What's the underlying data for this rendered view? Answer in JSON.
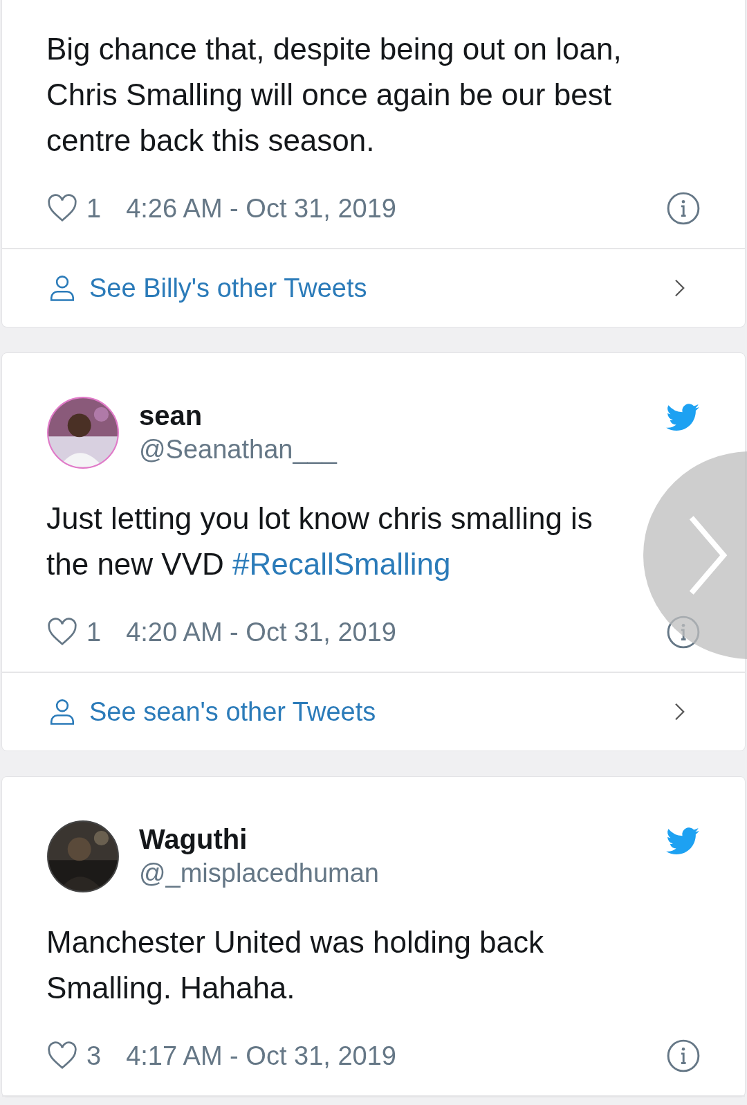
{
  "tweets": [
    {
      "text": "Big chance that, despite being out on loan, Chris Smalling will once again be our best centre back this season.",
      "likes": "1",
      "time": "4:26 AM - Oct 31, 2019",
      "more_link": "See Billy's other Tweets"
    },
    {
      "name": "sean",
      "handle": "@Seanathan___",
      "text": "Just letting you lot know chris smalling is the new VVD",
      "hashtag": "#RecallSmalling",
      "likes": "1",
      "time": "4:20 AM - Oct 31, 2019",
      "more_link": "See sean's other Tweets"
    },
    {
      "name": "Waguthi",
      "handle": "@_misplacedhuman",
      "text": "Manchester United was holding back Smalling. Hahaha.",
      "likes": "3",
      "time": "4:17 AM - Oct 31, 2019"
    }
  ]
}
